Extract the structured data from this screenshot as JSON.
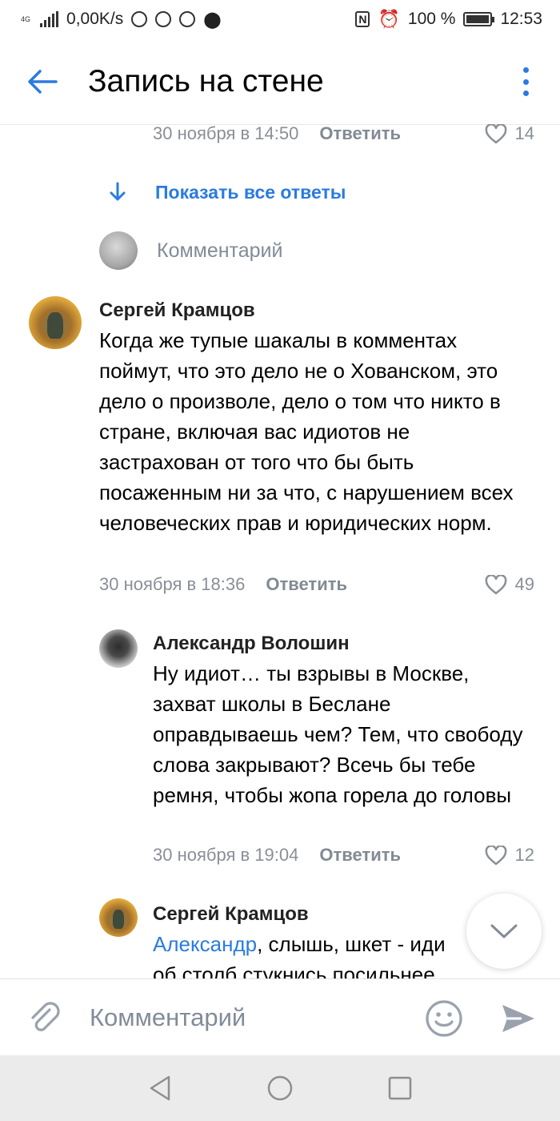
{
  "status_bar": {
    "network_label": "4G",
    "speed": "0,00K/s",
    "battery_percent": "100 %",
    "time": "12:53"
  },
  "header": {
    "title": "Запись на стене"
  },
  "top_reply_meta": {
    "date": "30 ноября в 14:50",
    "reply_label": "Ответить",
    "likes": "14"
  },
  "show_all_replies": "Показать все ответы",
  "comment_prompt": "Комментарий",
  "comments": [
    {
      "author": "Сергей Крамцов",
      "text": "Когда же тупые шакалы в комментах поймут, что это дело не о Хованском, это дело о произволе, дело о том что никто в стране, включая вас идиотов не застрахован от того что бы быть посаженным ни за что, с нарушением всех человеческих прав и юридических норм.",
      "date": "30 ноября в 18:36",
      "reply_label": "Ответить",
      "likes": "49"
    },
    {
      "author": "Александр Волошин",
      "text": "Ну идиот… ты взрывы в Москве, захват школы в Беслане оправдываешь чем? Тем, что свободу слова закрывают? Всечь бы тебе ремня, чтобы жопа горела до головы",
      "date": "30 ноября в 19:04",
      "reply_label": "Ответить",
      "likes": "12"
    },
    {
      "author": "Сергей Крамцов",
      "mention": "Александр",
      "text": ", слышь, шкет - иди об столб стукнись посильнее."
    }
  ],
  "composer": {
    "placeholder": "Комментарий"
  },
  "colors": {
    "accent": "#2a7be0",
    "secondary_text": "#8a8f97",
    "nav_bar": "#ebebeb"
  },
  "icons": [
    "back-arrow-icon",
    "more-vertical-icon",
    "arrow-down-icon",
    "heart-icon",
    "chevron-down-icon",
    "paperclip-icon",
    "smile-icon",
    "send-icon",
    "nav-back-icon",
    "nav-home-icon",
    "nav-recents-icon"
  ]
}
